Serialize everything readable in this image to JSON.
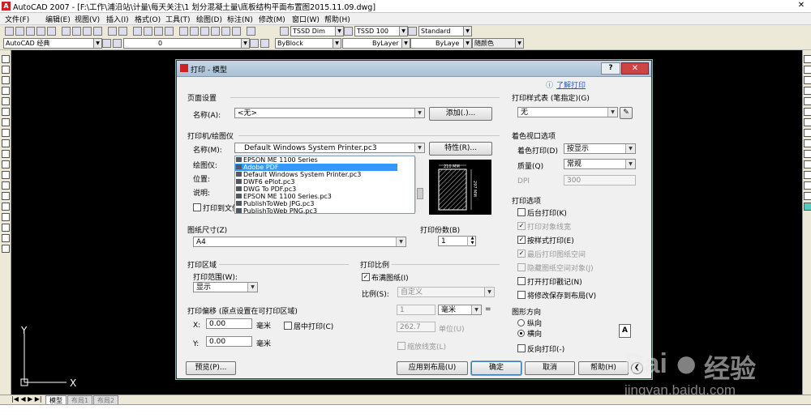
{
  "app": {
    "title": "AutoCAD 2007 - [F:\\工作\\浦沿站\\计量\\每天关注\\1 划分混凝土量\\底板结构平面布置图2015.11.09.dwg]",
    "icon_label": "A",
    "menu": [
      "文件(F)",
      "编辑(E)",
      "视图(V)",
      "插入(I)",
      "格式(O)",
      "工具(T)",
      "绘图(D)",
      "标注(N)",
      "修改(M)",
      "窗口(W)",
      "帮助(H)"
    ],
    "toolbar1": {
      "text_style": "TSSD Dim",
      "dim_style": "TSSD 100",
      "table_style": "Standard"
    },
    "toolbar2": {
      "workspace": "AutoCAD 经典",
      "layer": "0",
      "color": "ByBlock",
      "linetype": "ByLayer",
      "lineweight": "ByLaye",
      "plot_style": "随颜色"
    },
    "tabs": [
      "模型",
      "布局1",
      "布局2"
    ],
    "ucs": {
      "y": "Y",
      "x": "X"
    }
  },
  "watermark": {
    "brand": "Bai",
    "brand2": "经验",
    "url": "jingyan.baidu.com"
  },
  "dialog": {
    "title": "打印 - 模型",
    "help_link": "了解打印",
    "page_setup": {
      "section": "页面设置",
      "name_label": "名称(A):",
      "name_value": "<无>",
      "add_button": "添加(.)..."
    },
    "printer": {
      "section": "打印机/绘图仪",
      "name_label": "名称(M):",
      "name_value": "Default Windows System Printer.pc3",
      "properties_button": "特性(R)...",
      "plotter_label": "绘图仪:",
      "location_label": "位置:",
      "description_label": "说明:",
      "plot_to_file": "打印到文件",
      "list": [
        "EPSON ME 1100 Series",
        "Adobe PDF",
        "Default Windows System Printer.pc3",
        "DWF6 ePlot.pc3",
        "DWG To PDF.pc3",
        "EPSON ME 1100 Series.pc3",
        "PublishToWeb JPG.pc3",
        "PublishToWeb PNG.pc3"
      ],
      "selected_index": 1,
      "preview_width": "210 MM",
      "preview_height": "297 MM"
    },
    "paper_size": {
      "section": "图纸尺寸(Z)",
      "value": "A4"
    },
    "copies": {
      "section": "打印份数(B)",
      "value": "1"
    },
    "plot_area": {
      "section": "打印区域",
      "range_label": "打印范围(W):",
      "range_value": "显示"
    },
    "plot_offset": {
      "section": "打印偏移 (原点设置在可打印区域)",
      "x_label": "X:",
      "x_value": "0.00",
      "y_label": "Y:",
      "y_value": "0.00",
      "unit": "毫米",
      "center": "居中打印(C)"
    },
    "plot_scale": {
      "section": "打印比例",
      "fit": "布满图纸(I)",
      "scale_label": "比例(S):",
      "scale_value": "自定义",
      "v1": "1",
      "unit": "毫米",
      "v2": "262.7",
      "unit2": "单位(U)",
      "lineweights": "缩放线宽(L)"
    },
    "plot_style_table": {
      "section": "打印样式表 (笔指定)(G)",
      "value": "无"
    },
    "shaded_viewport": {
      "section": "着色视口选项",
      "shade_label": "着色打印(D)",
      "shade_value": "按显示",
      "quality_label": "质量(Q)",
      "quality_value": "常规",
      "dpi_label": "DPI",
      "dpi_value": "300"
    },
    "plot_options": {
      "section": "打印选项",
      "items": [
        {
          "label": "后台打印(K)",
          "checked": false,
          "enabled": true
        },
        {
          "label": "打印对象线宽",
          "checked": true,
          "enabled": false
        },
        {
          "label": "按样式打印(E)",
          "checked": true,
          "enabled": true
        },
        {
          "label": "最后打印图纸空间",
          "checked": true,
          "enabled": false
        },
        {
          "label": "隐藏图纸空间对象(J)",
          "checked": false,
          "enabled": false
        },
        {
          "label": "打开打印戳记(N)",
          "checked": false,
          "enabled": true
        },
        {
          "label": "将修改保存到布局(V)",
          "checked": false,
          "enabled": true
        }
      ]
    },
    "orientation": {
      "section": "图形方向",
      "portrait": "纵向",
      "landscape": "横向",
      "reverse": "反向打印(-)"
    },
    "buttons": {
      "preview": "预览(P)...",
      "apply": "应用到布局(U)",
      "ok": "确定",
      "cancel": "取消",
      "help": "帮助(H)"
    }
  }
}
